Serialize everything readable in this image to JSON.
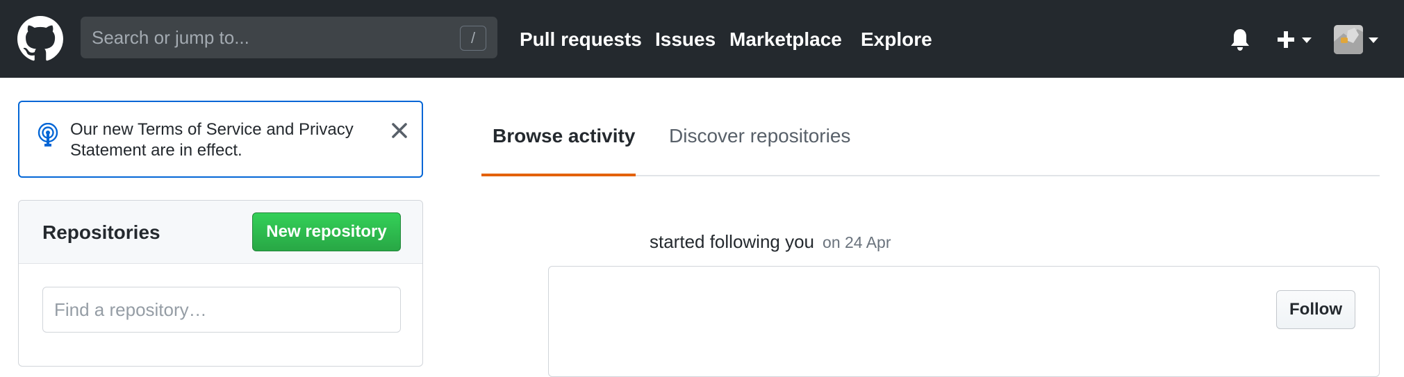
{
  "header": {
    "search": {
      "placeholder": "Search or jump to...",
      "shortcut": "/"
    },
    "nav": [
      {
        "label": "Pull requests"
      },
      {
        "label": "Issues"
      },
      {
        "label": "Marketplace"
      },
      {
        "label": "Explore"
      }
    ],
    "icons": {
      "logo": "github-mark-icon",
      "notifications": "bell-icon",
      "create": "plus-icon"
    }
  },
  "notice": {
    "text": "Our new Terms of Service and Privacy Statement are in effect.",
    "icon": "broadcast-icon",
    "close_icon": "x-icon"
  },
  "repositories": {
    "title": "Repositories",
    "new_button": "New repository",
    "find_placeholder": "Find a repository…"
  },
  "tabs": [
    {
      "label": "Browse activity",
      "active": true
    },
    {
      "label": "Discover repositories",
      "active": false
    }
  ],
  "activity": {
    "text": "started following you",
    "time": "on 24 Apr",
    "follow_button": "Follow"
  },
  "colors": {
    "header_bg": "#24292e",
    "accent_blue": "#0366d6",
    "green_button": "#28a745",
    "tab_underline": "#e36209"
  }
}
